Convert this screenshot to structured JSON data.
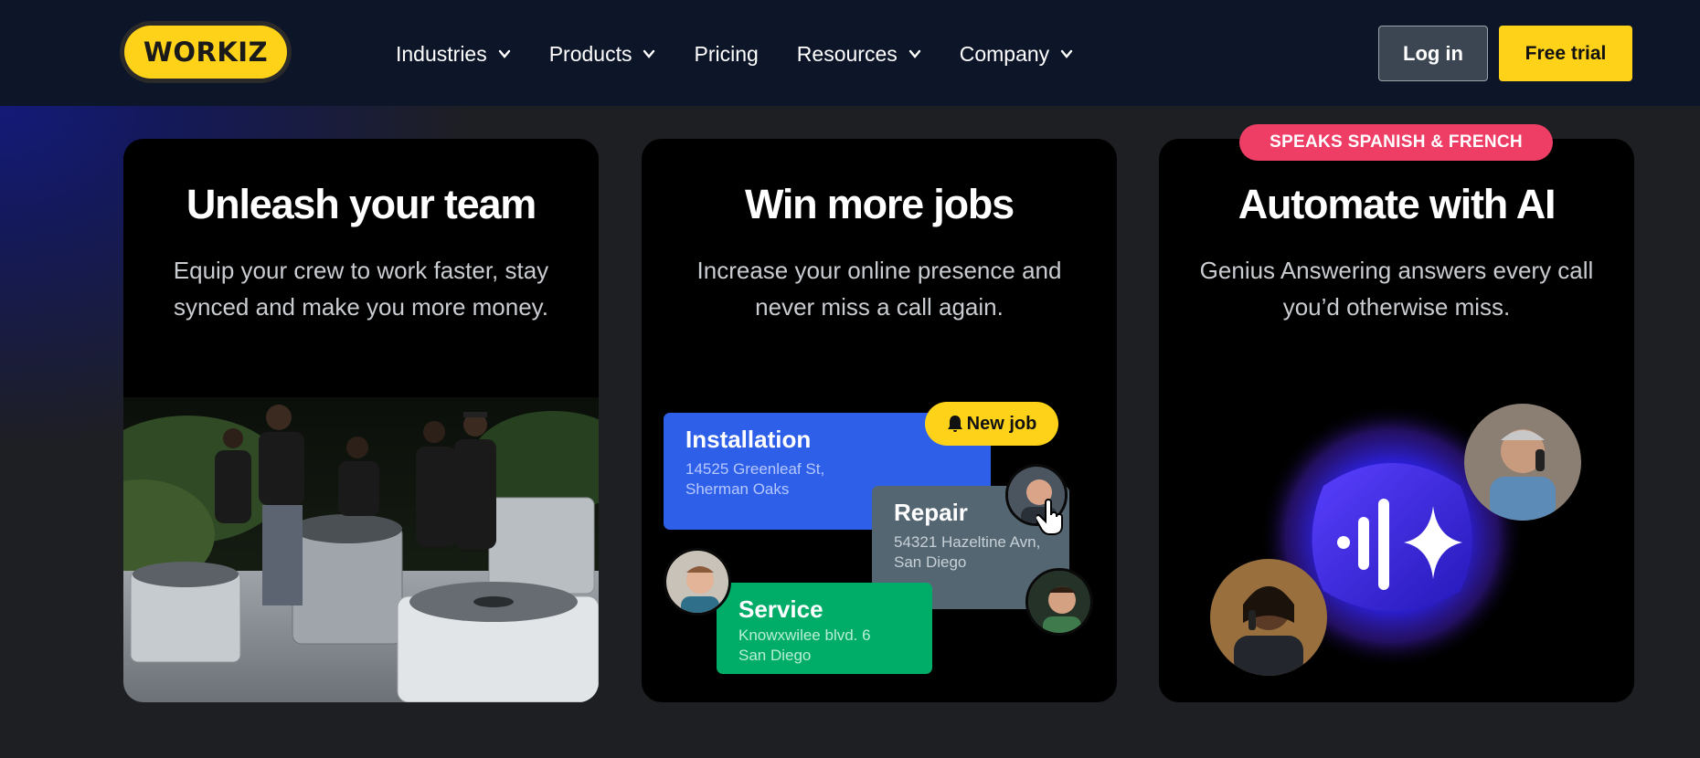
{
  "nav": {
    "logo": "WORKIZ",
    "items": [
      {
        "label": "Industries",
        "has_dropdown": true
      },
      {
        "label": "Products",
        "has_dropdown": true
      },
      {
        "label": "Pricing",
        "has_dropdown": false
      },
      {
        "label": "Resources",
        "has_dropdown": true
      },
      {
        "label": "Company",
        "has_dropdown": true
      }
    ],
    "login_label": "Log in",
    "trial_label": "Free trial"
  },
  "cards": [
    {
      "title": "Unleash your team",
      "description": "Equip your crew to work faster, stay synced and make you more money."
    },
    {
      "title": "Win more jobs",
      "description": "Increase your online presence and never miss a call again.",
      "new_job_label": "New job",
      "jobs": [
        {
          "title": "Installation",
          "address_line1": "14525 Greenleaf St,",
          "address_line2": "Sherman Oaks"
        },
        {
          "title": "Repair",
          "address_line1": "54321 Hazeltine Avn,",
          "address_line2": "San Diego"
        },
        {
          "title": "Service",
          "address_line1": "Knowxwilee blvd. 6",
          "address_line2": "San Diego"
        }
      ]
    },
    {
      "badge": "SPEAKS SPANISH & FRENCH",
      "title": "Automate with AI",
      "description": "Genius Answering answers every call you’d otherwise miss."
    }
  ],
  "colors": {
    "brand_yellow": "#ffd21a",
    "nav_bg": "#0d1528",
    "badge_pink": "#ee3e66",
    "installation_blue": "#2e5fe8",
    "repair_gray": "#546672",
    "service_green": "#00ad68"
  }
}
